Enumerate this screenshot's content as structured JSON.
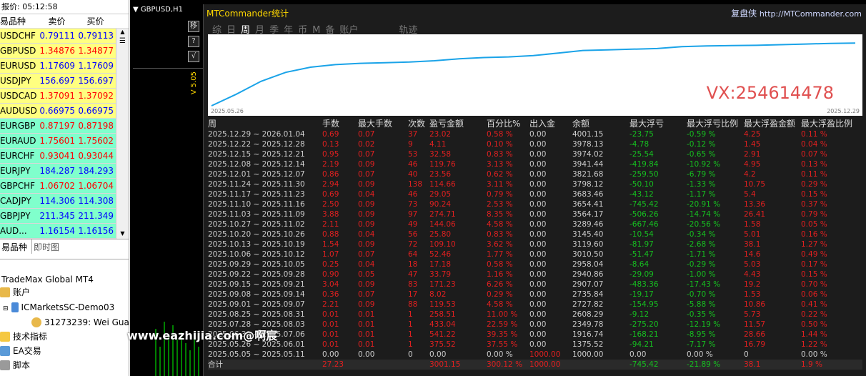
{
  "market_watch": {
    "title": "报价: 05:12:58",
    "headers": [
      "易品种",
      "卖价",
      "买价"
    ],
    "rows": [
      {
        "sym": "USDCHF",
        "bid": "0.79111",
        "ask": "0.79113",
        "bg": "#ffff80",
        "c": "#0000ff"
      },
      {
        "sym": "GBPUSD",
        "bid": "1.34876",
        "ask": "1.34877",
        "bg": "#ffff80",
        "c": "#ff0000"
      },
      {
        "sym": "EURUSD",
        "bid": "1.17609",
        "ask": "1.17609",
        "bg": "#ffff80",
        "c": "#0000ff"
      },
      {
        "sym": "USDJPY",
        "bid": "156.697",
        "ask": "156.697",
        "bg": "#ffff80",
        "c": "#0000ff"
      },
      {
        "sym": "USDCAD",
        "bid": "1.37091",
        "ask": "1.37092",
        "bg": "#ffff80",
        "c": "#ff0000"
      },
      {
        "sym": "AUDUSD",
        "bid": "0.66975",
        "ask": "0.66975",
        "bg": "#ffff80",
        "c": "#0000ff"
      },
      {
        "sym": "EURGBP",
        "bid": "0.87197",
        "ask": "0.87198",
        "bg": "#80ffcc",
        "c": "#ff0000"
      },
      {
        "sym": "EURAUD",
        "bid": "1.75601",
        "ask": "1.75602",
        "bg": "#80ffcc",
        "c": "#ff0000"
      },
      {
        "sym": "EURCHF",
        "bid": "0.93041",
        "ask": "0.93044",
        "bg": "#80ffcc",
        "c": "#ff0000"
      },
      {
        "sym": "EURJPY",
        "bid": "184.287",
        "ask": "184.293",
        "bg": "#80ffcc",
        "c": "#0000ff"
      },
      {
        "sym": "GBPCHF",
        "bid": "1.06702",
        "ask": "1.06704",
        "bg": "#80ffcc",
        "c": "#ff0000"
      },
      {
        "sym": "CADJPY",
        "bid": "114.306",
        "ask": "114.308",
        "bg": "#80ffcc",
        "c": "#0000ff"
      },
      {
        "sym": "GBPJPY",
        "bid": "211.345",
        "ask": "211.349",
        "bg": "#80ffcc",
        "c": "#0000ff"
      },
      {
        "sym": "AUD...",
        "bid": "1.16154",
        "ask": "1.16156",
        "bg": "#80ffcc",
        "c": "#0000ff"
      }
    ],
    "tabs": [
      "易品种",
      "即时图"
    ]
  },
  "navigator": {
    "root": "TradeMax Global MT4",
    "accounts": "账户",
    "server": "ICMarketsSC-Demo03",
    "account": "31273239: Wei Gua",
    "indicators": "技术指标",
    "ea": "EA交易",
    "scripts": "脚本"
  },
  "chart": {
    "symbol": "GBPUSD,H1",
    "version": "V 5.05",
    "btn1": "移",
    "btn2": "?",
    "btn3": "√"
  },
  "mt": {
    "title": "MTCommander统计",
    "brand": "复盘侠",
    "url": "http://MTCommander.com",
    "tabs": [
      "综",
      "日",
      "周",
      "月",
      "季",
      "年",
      "币",
      "M",
      "备",
      "账户",
      "轨迹"
    ],
    "active_tab": "周",
    "start_date": "2025.05.26",
    "end_date": "2025.12.29",
    "overlay": "VX:254614478",
    "headers": [
      "周",
      "手数",
      "最大手数",
      "次数",
      "盈亏金额",
      "百分比%",
      "出入金",
      "余额",
      "最大浮亏",
      "最大浮亏比例",
      "最大浮盈金额",
      "最大浮盈比例"
    ],
    "rows": [
      [
        "2025.12.29 ~ 2026.01.04",
        "0.69",
        "0.07",
        "37",
        "23.02",
        "0.58 %",
        "0.00",
        "4001.15",
        "-23.75",
        "-0.59 %",
        "4.25",
        "0.11 %"
      ],
      [
        "2025.12.22 ~ 2025.12.28",
        "0.13",
        "0.02",
        "9",
        "4.11",
        "0.10 %",
        "0.00",
        "3978.13",
        "-4.78",
        "-0.12 %",
        "1.45",
        "0.04 %"
      ],
      [
        "2025.12.15 ~ 2025.12.21",
        "0.95",
        "0.07",
        "53",
        "32.58",
        "0.83 %",
        "0.00",
        "3974.02",
        "-25.54",
        "-0.65 %",
        "2.91",
        "0.07 %"
      ],
      [
        "2025.12.08 ~ 2025.12.14",
        "2.19",
        "0.09",
        "46",
        "119.76",
        "3.13 %",
        "0.00",
        "3941.44",
        "-419.84",
        "-10.92 %",
        "4.95",
        "0.13 %"
      ],
      [
        "2025.12.01 ~ 2025.12.07",
        "0.86",
        "0.07",
        "40",
        "23.56",
        "0.62 %",
        "0.00",
        "3821.68",
        "-259.50",
        "-6.79 %",
        "4.2",
        "0.11 %"
      ],
      [
        "2025.11.24 ~ 2025.11.30",
        "2.94",
        "0.09",
        "138",
        "114.66",
        "3.11 %",
        "0.00",
        "3798.12",
        "-50.10",
        "-1.33 %",
        "10.75",
        "0.29 %"
      ],
      [
        "2025.11.17 ~ 2025.11.23",
        "0.69",
        "0.04",
        "46",
        "29.05",
        "0.79 %",
        "0.00",
        "3683.46",
        "-43.12",
        "-1.17 %",
        "5.4",
        "0.15 %"
      ],
      [
        "2025.11.10 ~ 2025.11.16",
        "2.50",
        "0.09",
        "73",
        "90.24",
        "2.53 %",
        "0.00",
        "3654.41",
        "-745.42",
        "-20.91 %",
        "13.36",
        "0.37 %"
      ],
      [
        "2025.11.03 ~ 2025.11.09",
        "3.88",
        "0.09",
        "97",
        "274.71",
        "8.35 %",
        "0.00",
        "3564.17",
        "-506.26",
        "-14.74 %",
        "26.41",
        "0.79 %"
      ],
      [
        "2025.10.27 ~ 2025.11.02",
        "2.11",
        "0.09",
        "49",
        "144.06",
        "4.58 %",
        "0.00",
        "3289.46",
        "-667.46",
        "-20.56 %",
        "1.58",
        "0.05 %"
      ],
      [
        "2025.10.20 ~ 2025.10.26",
        "0.88",
        "0.04",
        "56",
        "25.80",
        "0.83 %",
        "0.00",
        "3145.40",
        "-10.54",
        "-0.34 %",
        "5.01",
        "0.16 %"
      ],
      [
        "2025.10.13 ~ 2025.10.19",
        "1.54",
        "0.09",
        "72",
        "109.10",
        "3.62 %",
        "0.00",
        "3119.60",
        "-81.97",
        "-2.68 %",
        "38.1",
        "1.27 %"
      ],
      [
        "2025.10.06 ~ 2025.10.12",
        "1.07",
        "0.07",
        "64",
        "52.46",
        "1.77 %",
        "0.00",
        "3010.50",
        "-51.47",
        "-1.71 %",
        "14.6",
        "0.49 %"
      ],
      [
        "2025.09.29 ~ 2025.10.05",
        "0.25",
        "0.04",
        "18",
        "17.18",
        "0.58 %",
        "0.00",
        "2958.04",
        "-8.64",
        "-0.29 %",
        "5.03",
        "0.17 %"
      ],
      [
        "2025.09.22 ~ 2025.09.28",
        "0.90",
        "0.05",
        "47",
        "33.79",
        "1.16 %",
        "0.00",
        "2940.86",
        "-29.09",
        "-1.00 %",
        "4.43",
        "0.15 %"
      ],
      [
        "2025.09.15 ~ 2025.09.21",
        "3.04",
        "0.09",
        "83",
        "171.23",
        "6.26 %",
        "0.00",
        "2907.07",
        "-483.36",
        "-17.43 %",
        "19.2",
        "0.70 %"
      ],
      [
        "2025.09.08 ~ 2025.09.14",
        "0.36",
        "0.07",
        "17",
        "8.02",
        "0.29 %",
        "0.00",
        "2735.84",
        "-19.17",
        "-0.70 %",
        "1.53",
        "0.06 %"
      ],
      [
        "2025.09.01 ~ 2025.09.07",
        "2.21",
        "0.09",
        "88",
        "119.53",
        "4.58 %",
        "0.00",
        "2727.82",
        "-154.95",
        "-5.88 %",
        "10.86",
        "0.41 %"
      ],
      [
        "2025.08.25 ~ 2025.08.31",
        "0.01",
        "0.01",
        "1",
        "258.51",
        "11.00 %",
        "0.00",
        "2608.29",
        "-9.12",
        "-0.35 %",
        "5.73",
        "0.22 %"
      ],
      [
        "2025.07.28 ~ 2025.08.03",
        "0.01",
        "0.01",
        "1",
        "433.04",
        "22.59 %",
        "0.00",
        "2349.78",
        "-275.20",
        "-12.19 %",
        "11.57",
        "0.50 %"
      ],
      [
        "2025.06.30 ~ 2025.07.06",
        "0.01",
        "0.01",
        "1",
        "541.22",
        "39.35 %",
        "0.00",
        "1916.74",
        "-168.21",
        "-8.95 %",
        "28.66",
        "1.44 %"
      ],
      [
        "2025.05.26 ~ 2025.06.01",
        "0.01",
        "0.01",
        "1",
        "375.52",
        "37.55 %",
        "0.00",
        "1375.52",
        "-94.21",
        "-7.17 %",
        "16.79",
        "1.22 %"
      ],
      [
        "2025.05.05 ~ 2025.05.11",
        "0.00",
        "0.00",
        "0",
        "0.00",
        "0.00 %",
        "1000.00",
        "1000.00",
        "0.00",
        "0.00 %",
        "0",
        "0.00 %"
      ]
    ],
    "total": [
      "合计",
      "27.23",
      "",
      "",
      "3001.15",
      "300.12 %",
      "1000.00",
      "",
      "-745.42",
      "-21.89 %",
      "38.1",
      "1.9 %"
    ]
  },
  "watermark": "www.eazhijia.com@啊宸",
  "equity_curve": [
    0,
    0.18,
    0.38,
    0.52,
    0.6,
    0.64,
    0.66,
    0.67,
    0.68,
    0.7,
    0.73,
    0.75,
    0.76,
    0.78,
    0.82,
    0.86,
    0.87,
    0.88,
    0.89,
    0.92,
    0.93,
    0.935,
    0.94,
    0.95,
    0.96,
    0.97,
    0.975
  ]
}
